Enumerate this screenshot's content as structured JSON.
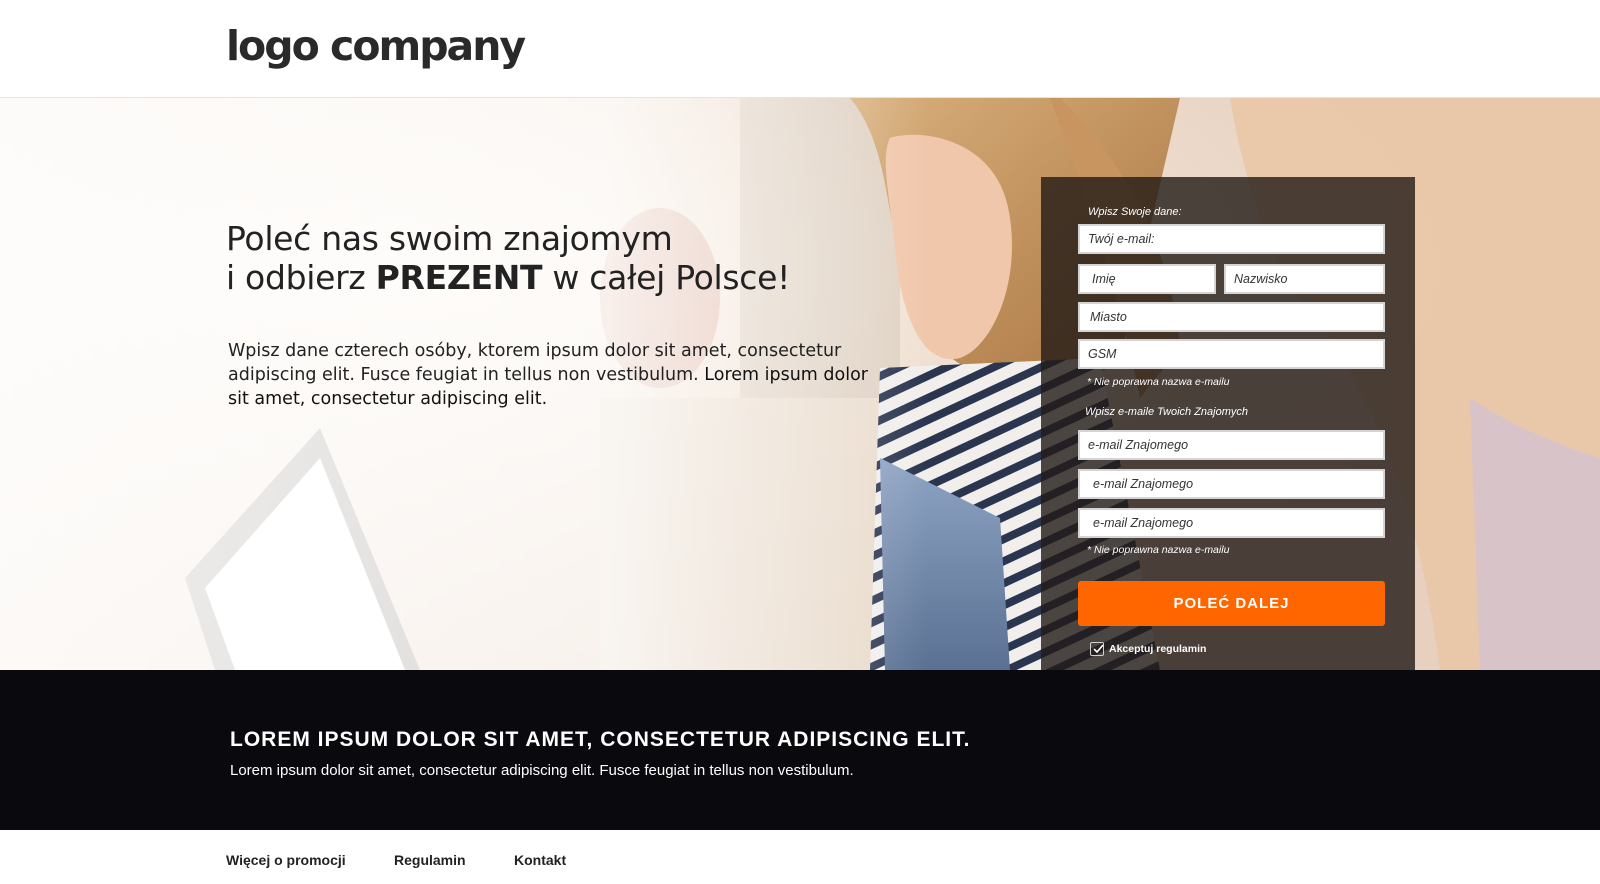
{
  "header": {
    "logo_text": "logo company"
  },
  "hero": {
    "headline_line1": "Poleć nas swoim znajomym",
    "headline_line2_prefix": "i odbierz ",
    "headline_line2_bold": "PREZENT",
    "headline_line2_suffix": " w całej Polsce!",
    "intro_regular": "Wpisz dane czterech osóby, ktorem ipsum dolor sit amet, consectetur adipiscing elit. Fusce feugiat in tellus non vestibulum. ",
    "intro_strong": "Lorem ipsum dolor sit amet, consectetur adipiscing elit."
  },
  "form": {
    "own_data_label": "Wpisz Swoje dane:",
    "email_placeholder": "Twój e-mail:",
    "first_name_placeholder": "Imię",
    "last_name_placeholder": "Nazwisko",
    "city_placeholder": "Miasto",
    "phone_placeholder": "GSM",
    "error_1": "* Nie poprawna nazwa e-mailu",
    "friends_label": "Wpisz e-maile Twoich Znajomych",
    "friend_email_1": "e-mail Znajomego",
    "friend_email_2": "e-mail Znajomego",
    "friend_email_3": "e-mail Znajomego",
    "error_2": "* Nie poprawna nazwa e-mailu",
    "submit_label": "POLEĆ DALEJ",
    "terms_label": "Akceptuj regulamin",
    "terms_checked": true
  },
  "band": {
    "title": "LOREM IPSUM DOLOR SIT AMET, CONSECTETUR ADIPISCING ELIT.",
    "text": "Lorem ipsum dolor sit amet, consectetur adipiscing elit. Fusce feugiat in tellus non vestibulum."
  },
  "footer": {
    "links": [
      "Więcej o promocji",
      "Regulamin",
      "Kontakt"
    ]
  },
  "colors": {
    "accent": "#ff6600",
    "band_bg": "#0a090d",
    "form_bg": "#221a16"
  }
}
